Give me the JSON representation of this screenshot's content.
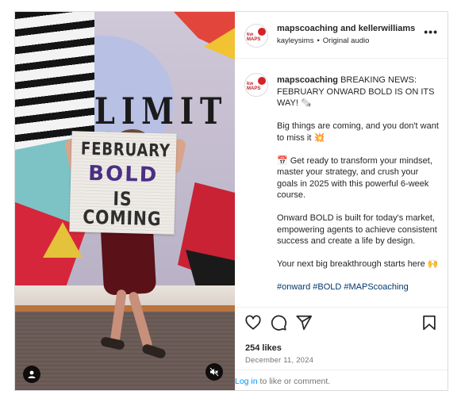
{
  "header": {
    "title": "mapscoaching and kellerwilliams",
    "username": "kayleysims",
    "separator": "•",
    "audio": "Original audio",
    "more_label": "•••",
    "avatar_text": "kw MAPS"
  },
  "media": {
    "wall_text": "LIMIT",
    "sign_lines": [
      "FEBRUARY",
      "BOLD",
      "IS COMING"
    ]
  },
  "caption": {
    "username": "mapscoaching",
    "first_paragraph": "BREAKING NEWS: FEBRUARY ONWARD BOLD IS ON ITS WAY! 🗞️",
    "paragraphs": [
      "Big things are coming, and you don't want to miss it 💥",
      "📅 Get ready to transform your mindset, master your strategy, and crush your goals in 2025 with this powerful 6-week course.",
      "Onward BOLD is built for today's market, empowering agents to achieve consistent success and create a life by design.",
      "Your next big breakthrough starts here 🙌"
    ],
    "hashtags": "#onward #BOLD #MAPScoaching"
  },
  "actions": {
    "likes": "254 likes",
    "date": "December 11, 2024"
  },
  "login": {
    "link": "Log in",
    "rest": " to like or comment."
  },
  "colors": {
    "link": "#0095f6",
    "muted": "#737373",
    "text": "#262626",
    "brand_red": "#d2232a"
  },
  "icons": [
    "user-tag-icon",
    "mute-icon",
    "more-icon",
    "heart-icon",
    "comment-icon",
    "share-icon",
    "bookmark-icon"
  ]
}
